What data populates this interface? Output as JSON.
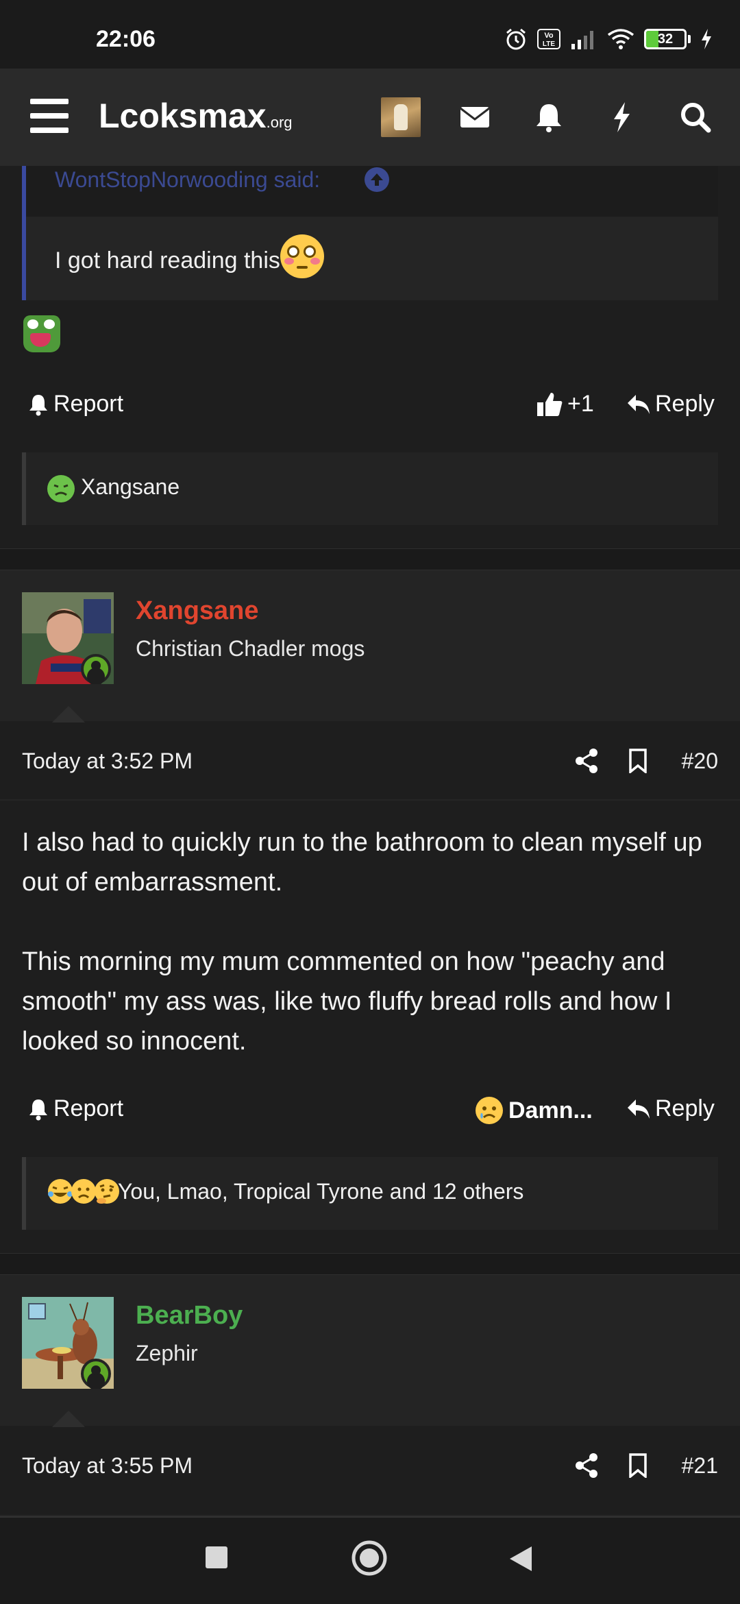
{
  "status_bar": {
    "time": "22:06",
    "battery": "32",
    "battery_level": 0.32
  },
  "header": {
    "logo_main": "Lcoksmax",
    "logo_tld": ".org"
  },
  "quote": {
    "author": "WontStopNorwooding said:",
    "text": "I got hard reading this"
  },
  "post19": {
    "actions": {
      "report": "Report",
      "like": "+1",
      "reply": "Reply"
    },
    "reactions_text": "Xangsane"
  },
  "post20": {
    "username": "Xangsane",
    "user_color": "#e0452f",
    "user_title": "Christian Chadler mogs",
    "date": "Today at 3:52 PM",
    "number": "#20",
    "paragraphs": [
      "I also had to quickly run to the bathroom to clean myself up out of embarrassment.",
      "This morning my mum commented on how \"peachy and smooth\" my ass was, like two fluffy bread rolls and how I looked so innocent."
    ],
    "actions": {
      "report": "Report",
      "reaction": "Damn...",
      "reply": "Reply"
    },
    "reactions_text": "You, Lmao, Tropical Tyrone and 12 others"
  },
  "post21": {
    "username": "BearBoy",
    "user_color": "#4caf50",
    "user_title": "Zephir",
    "date": "Today at 3:55 PM",
    "number": "#21"
  }
}
